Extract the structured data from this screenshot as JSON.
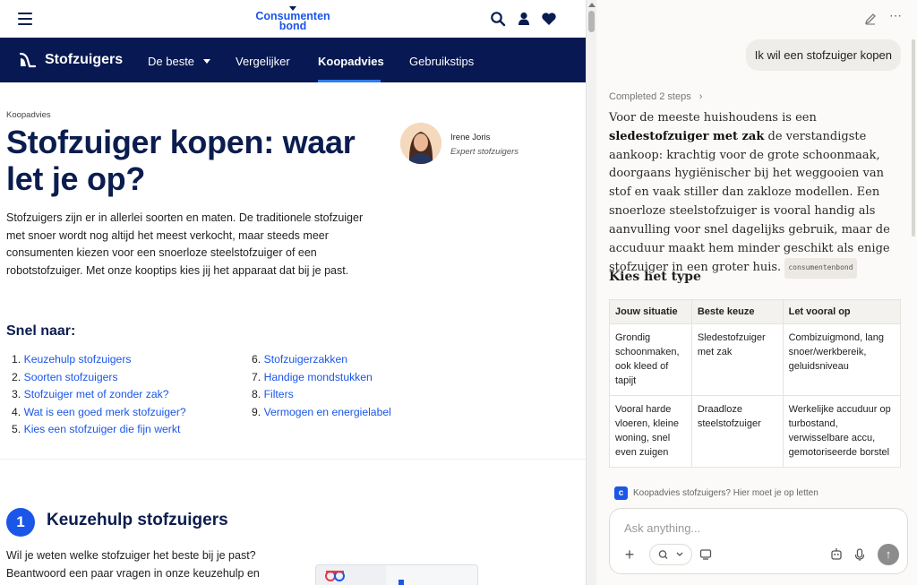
{
  "site": {
    "logo_line1": "Consumenten",
    "logo_line2": "bond",
    "nav": {
      "brand": "Stofzuigers",
      "items": [
        "De beste",
        "Vergelijker",
        "Koopadvies",
        "Gebruikstips"
      ],
      "active": "Koopadvies"
    },
    "article": {
      "breadcrumb": "Koopadvies",
      "title": "Stofzuiger kopen: waar let je op?",
      "author_name": "Irene Joris",
      "author_role": "Expert stofzuigers",
      "intro": "Stofzuigers zijn er in allerlei soorten en maten. De traditionele stofzuiger met snoer wordt nog altijd het meest verkocht, maar steeds meer consumenten kiezen voor een snoerloze steelstofzuiger of een robotstofzuiger. Met onze kooptips kies jij het apparaat dat bij je past.",
      "snel_naar_title": "Snel naar:",
      "snel_links": [
        "Keuzehulp stofzuigers",
        "Soorten stofzuigers",
        "Stofzuiger met of zonder zak?",
        "Wat is een goed merk stofzuiger?",
        "Kies een stofzuiger die fijn werkt",
        "Stofzuigerzakken",
        "Handige mondstukken",
        "Filters",
        "Vermogen en energielabel"
      ],
      "section_number": "1",
      "section_title": "Keuzehulp stofzuigers",
      "section_body": "Wil je weten welke stofzuiger het beste bij je past? Beantwoord een paar vragen in onze keuzehulp en"
    }
  },
  "assistant": {
    "user_message": "Ik wil een stofzuiger kopen",
    "steps_label": "Completed 2 steps",
    "answer_pre": "Voor de meeste huishoudens is een ",
    "answer_bold": "sledestofzuiger met zak",
    "answer_post": " de verstandigste aankoop: krachtig voor de grote schoonmaak, doorgaans hygiënischer bij het weggooien van stof en vaak stiller dan zakloze modellen. Een snoerloze steelstofzuiger is vooral handig als aanvulling voor snel dagelijks gebruik, maar de accuduur maakt hem minder geschikt als enige stofzuiger in een groter huis.",
    "source_chip": "consumentenbond",
    "section_heading": "Kies het type",
    "table": {
      "headers": [
        "Jouw situatie",
        "Beste keuze",
        "Let vooral op"
      ],
      "rows": [
        [
          "Grondig schoonmaken, ook kleed of tapijt",
          "Sledestofzuiger met zak",
          "Combizuigmond, lang snoer/werkbereik, geluidsniveau"
        ],
        [
          "Vooral harde vloeren, kleine woning, snel even zuigen",
          "Draadloze steelstofzuiger",
          "Werkelijke accuduur op turbostand, verwisselbare accu, gemotoriseerde borstel"
        ]
      ]
    },
    "citation": "Koopadvies stofzuigers? Hier moet je op letten",
    "input_placeholder": "Ask anything...",
    "colors": {
      "brand_blue": "#1a56e8",
      "nav_navy": "#071852"
    }
  }
}
